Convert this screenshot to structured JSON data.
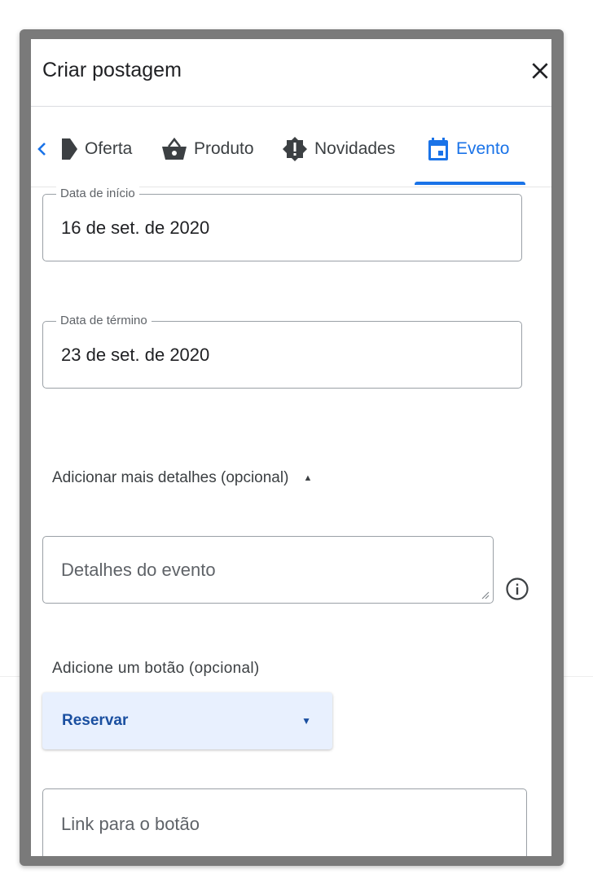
{
  "dialog": {
    "title": "Criar postagem",
    "close_icon": "close-icon"
  },
  "tabs": {
    "scroll_icon": "chevron-left-icon",
    "items": [
      {
        "label": "Oferta",
        "icon": "tag-icon"
      },
      {
        "label": "Produto",
        "icon": "basket-icon"
      },
      {
        "label": "Novidades",
        "icon": "badge-alert-icon"
      },
      {
        "label": "Evento",
        "icon": "calendar-icon",
        "active": true
      }
    ]
  },
  "form": {
    "start_date": {
      "label": "Data de início",
      "value": "16 de set. de 2020"
    },
    "end_date": {
      "label": "Data de término",
      "value": "23 de set. de 2020"
    },
    "more_details_toggle": "Adicionar mais detalhes (opcional)",
    "details": {
      "placeholder": "Detalhes do evento"
    },
    "button_section_label": "Adicione um botão (opcional)",
    "button_type": {
      "selected": "Reservar"
    },
    "button_link": {
      "placeholder": "Link para o botão"
    }
  },
  "colors": {
    "accent": "#1a73e8",
    "select_bg": "#e8f0fe",
    "frame": "#7a7a7a"
  }
}
